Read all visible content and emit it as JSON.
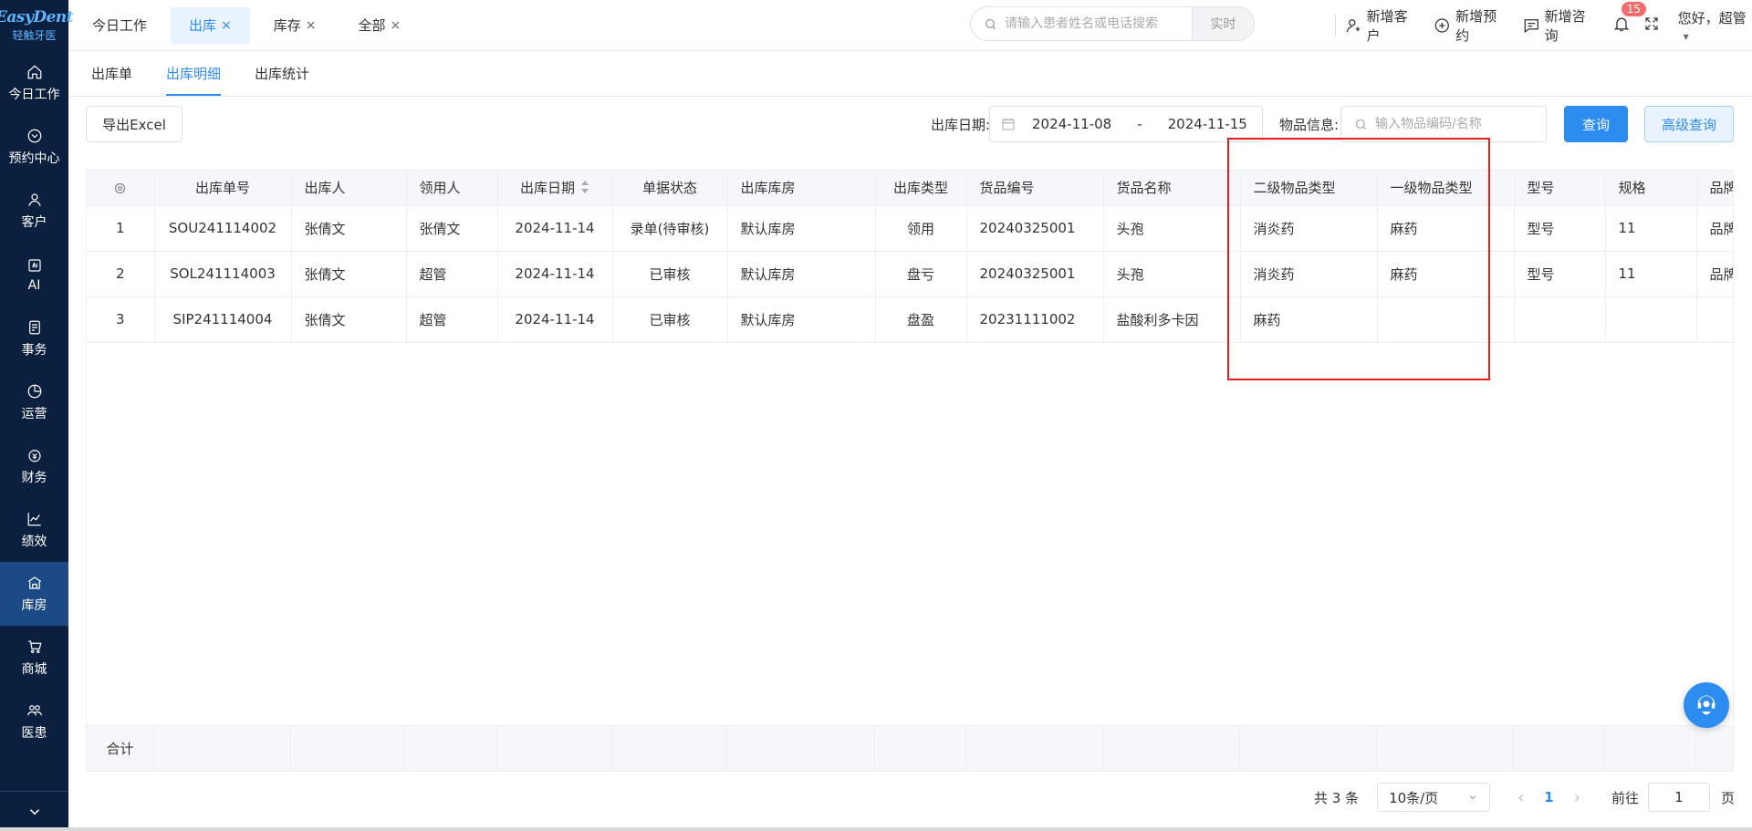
{
  "app": {
    "logo_text": "EasyDent",
    "logo_sub": "轻触牙医"
  },
  "sidebar": {
    "items": [
      {
        "label": "今日工作",
        "icon": "home-icon"
      },
      {
        "label": "预约中心",
        "icon": "appointment-icon"
      },
      {
        "label": "客户",
        "icon": "user-icon"
      },
      {
        "label": "AI",
        "icon": "ai-icon"
      },
      {
        "label": "事务",
        "icon": "task-icon"
      },
      {
        "label": "运营",
        "icon": "pie-icon"
      },
      {
        "label": "财务",
        "icon": "finance-icon"
      },
      {
        "label": "绩效",
        "icon": "chart-icon"
      },
      {
        "label": "库房",
        "icon": "warehouse-icon"
      },
      {
        "label": "商城",
        "icon": "cart-icon"
      },
      {
        "label": "医患",
        "icon": "doctor-patient-icon"
      }
    ],
    "active": "库房"
  },
  "topbar": {
    "tabs": [
      {
        "label": "今日工作",
        "closable": false
      },
      {
        "label": "出库",
        "closable": true
      },
      {
        "label": "库存",
        "closable": true
      },
      {
        "label": "全部",
        "closable": true
      }
    ],
    "close_glyph": "×",
    "search_placeholder": "请输入患者姓名或电话搜索",
    "search_mode": "实时",
    "actions": {
      "add_customer": "新增客户",
      "add_appointment": "新增预约",
      "add_consult": "新增咨询"
    },
    "notification_count": "15",
    "greeting": "您好，超管"
  },
  "subtabs": [
    "出库单",
    "出库明细",
    "出库统计"
  ],
  "toolbar": {
    "export": "导出Excel",
    "date_label": "出库日期:",
    "date_start": "2024-11-08",
    "date_sep": "-",
    "date_end": "2024-11-15",
    "goods_label": "物品信息:",
    "goods_placeholder": "输入物品编码/名称",
    "query": "查询",
    "advanced": "高级查询"
  },
  "table": {
    "headers": [
      "出库单号",
      "出库人",
      "领用人",
      "出库日期",
      "单据状态",
      "出库库房",
      "出库类型",
      "货品编号",
      "货品名称",
      "二级物品类型",
      "一级物品类型",
      "型号",
      "规格",
      "品牌"
    ],
    "rows": [
      [
        "1",
        "SOU241114002",
        "张倩文",
        "张倩文",
        "2024-11-14",
        "录单(待审核)",
        "默认库房",
        "领用",
        "20240325001",
        "头孢",
        "消炎药",
        "麻药",
        "型号",
        "11",
        "品牌"
      ],
      [
        "2",
        "SOL241114003",
        "张倩文",
        "超管",
        "2024-11-14",
        "已审核",
        "默认库房",
        "盘亏",
        "20240325001",
        "头孢",
        "消炎药",
        "麻药",
        "型号",
        "11",
        "品牌"
      ],
      [
        "3",
        "SIP241114004",
        "张倩文",
        "超管",
        "2024-11-14",
        "已审核",
        "默认库房",
        "盘盈",
        "20231111002",
        "盐酸利多卡因",
        "麻药",
        "",
        "",
        "",
        ""
      ]
    ],
    "summary_label": "合计"
  },
  "pagination": {
    "total": "共 3 条",
    "page_size": "10条/页",
    "current": "1",
    "goto_label": "前往",
    "goto_value": "1",
    "page_unit": "页"
  }
}
